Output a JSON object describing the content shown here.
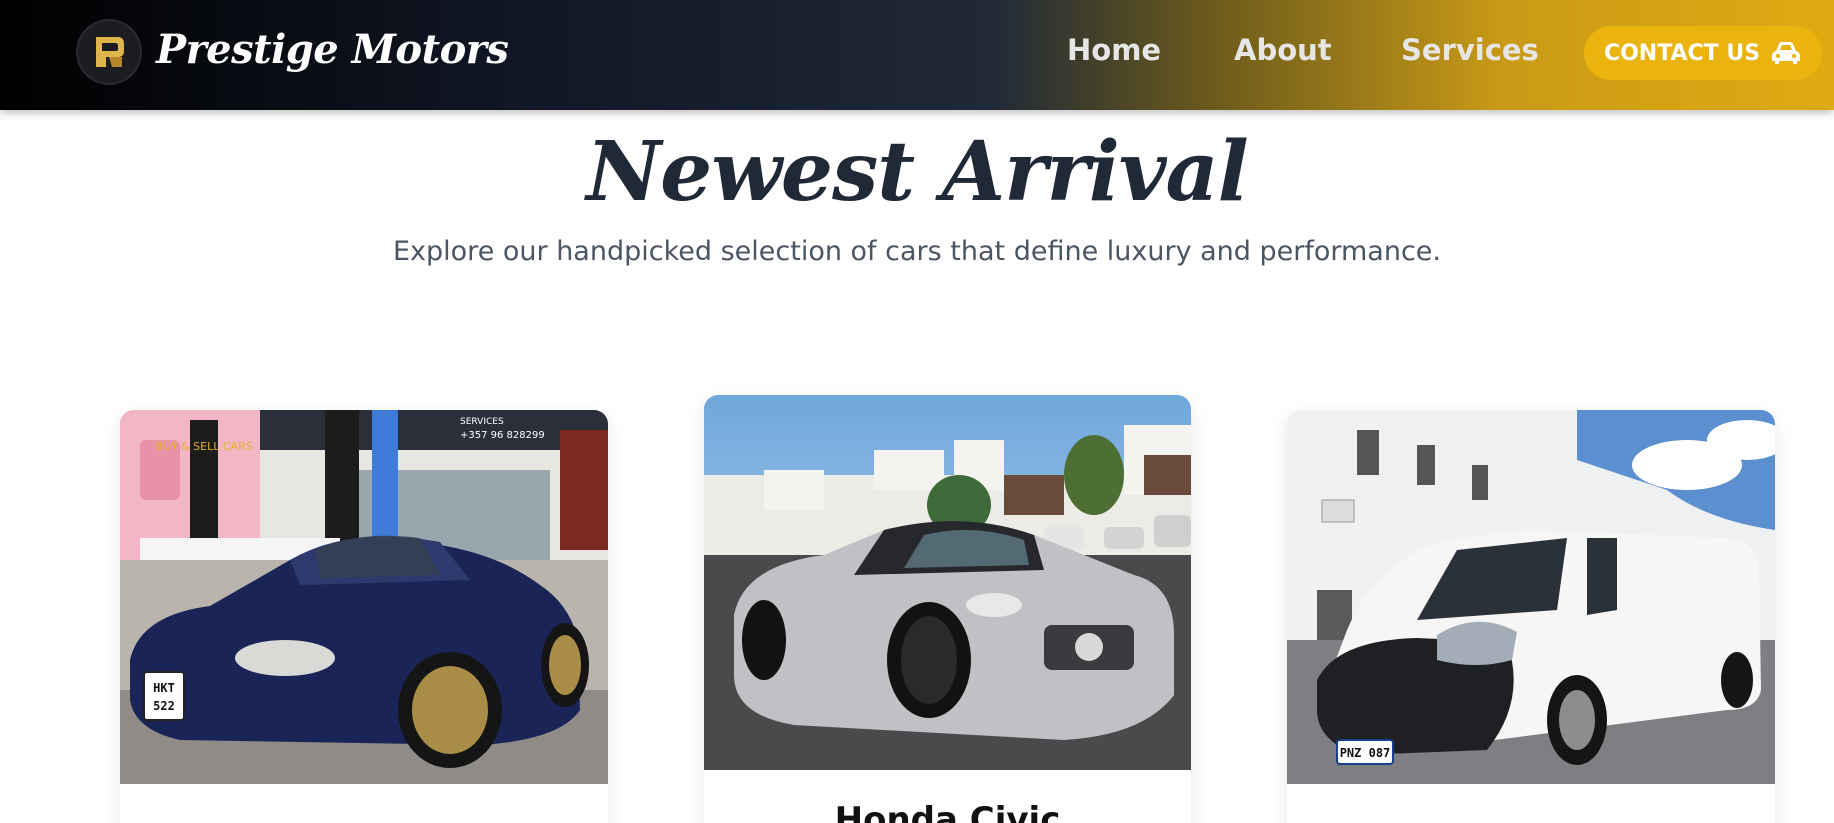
{
  "navbar": {
    "brand": "Prestige Motors",
    "links": [
      "Home",
      "About",
      "Services"
    ],
    "contact_label": "CONTACT US",
    "contact_icon": "car-icon",
    "accent_color": "#eab30d"
  },
  "section": {
    "title": "Newest Arrival",
    "subtitle": "Explore our handpicked selection of cars that define luxury and performance."
  },
  "cards": [
    {
      "image": "blue-convertible-photo",
      "plate": "HKT 522",
      "title": ""
    },
    {
      "image": "silver-mercedes-convertible-photo",
      "title": "Honda Civic"
    },
    {
      "image": "white-van-photo",
      "plate": "PNZ 087",
      "title": ""
    }
  ],
  "storefront": {
    "flag_text": "BUY & SELL CARS",
    "phone": "+357 96 828299",
    "sign": "SERVICES"
  }
}
